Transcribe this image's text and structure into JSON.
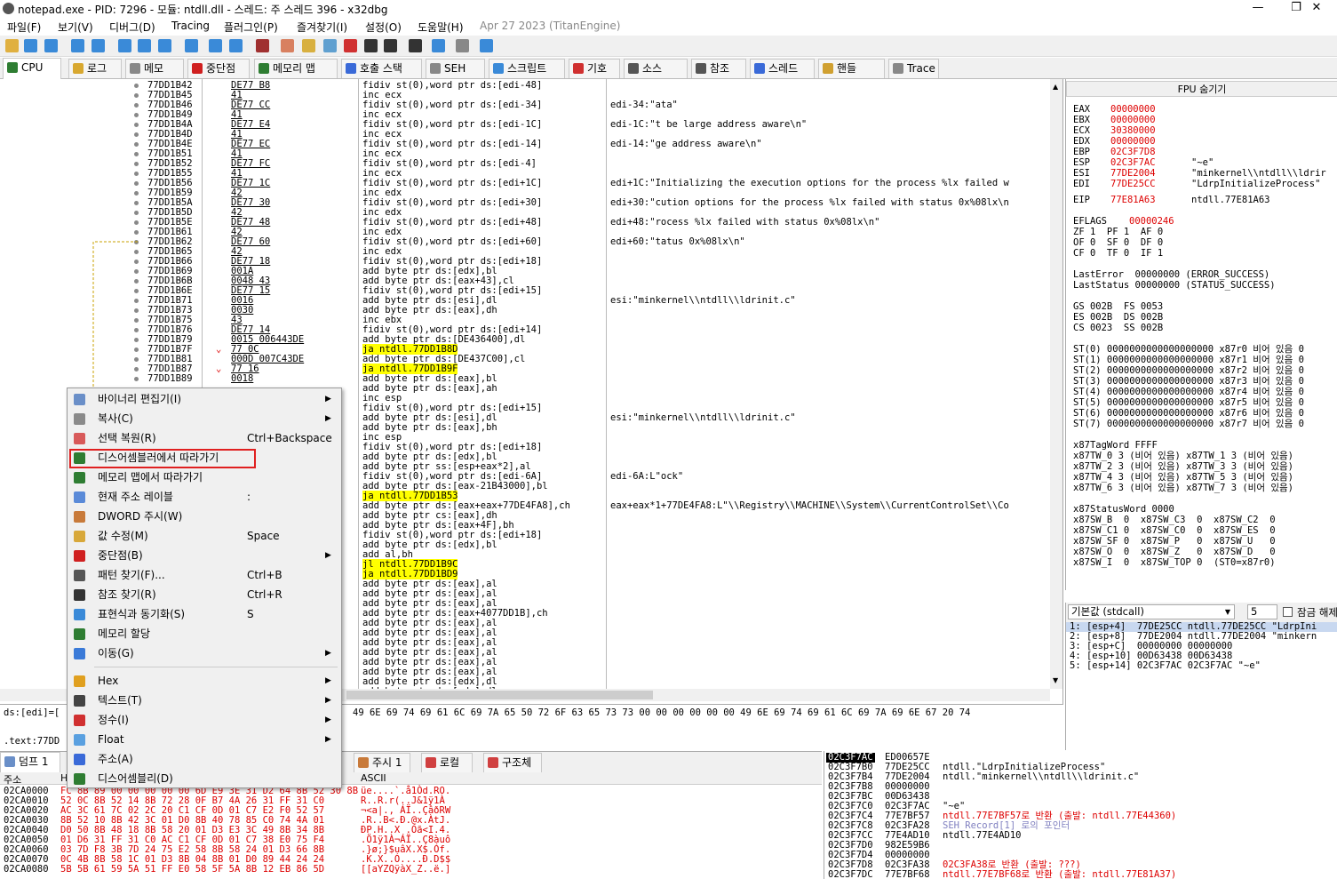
{
  "title": "notepad.exe - PID: 7296 - 모듈: ntdll.dll - 스레드: 주 스레드 396 - x32dbg",
  "menu": [
    "파일(F)",
    "보기(V)",
    "디버그(D)",
    "Tracing",
    "플러그인(P)",
    "즐겨찾기(I)",
    "설정(O)",
    "도움말(H)"
  ],
  "menu_date": "Apr 27 2023 (TitanEngine)",
  "tabs": [
    "CPU",
    "로그",
    "메모",
    "중단점",
    "메모리 맵",
    "호출 스택",
    "SEH",
    "스크립트",
    "기호",
    "소스",
    "참조",
    "스레드",
    "핸들",
    "Trace"
  ],
  "disasm": [
    {
      "a": "77DD1B42",
      "b": "DE77 B8",
      "i": "fidiv st(0),word ptr ds:[edi-48]",
      "c": ""
    },
    {
      "a": "77DD1B45",
      "b": "41",
      "i": "inc ecx",
      "c": ""
    },
    {
      "a": "77DD1B46",
      "b": "DE77 CC",
      "i": "fidiv st(0),word ptr ds:[edi-34]",
      "c": "edi-34:\"ata\""
    },
    {
      "a": "77DD1B49",
      "b": "41",
      "i": "inc ecx",
      "c": ""
    },
    {
      "a": "77DD1B4A",
      "b": "DE77 E4",
      "i": "fidiv st(0),word ptr ds:[edi-1C]",
      "c": "edi-1C:\"t be large address aware\\n\""
    },
    {
      "a": "77DD1B4D",
      "b": "41",
      "i": "inc ecx",
      "c": ""
    },
    {
      "a": "77DD1B4E",
      "b": "DE77 EC",
      "i": "fidiv st(0),word ptr ds:[edi-14]",
      "c": "edi-14:\"ge address aware\\n\""
    },
    {
      "a": "77DD1B51",
      "b": "41",
      "i": "inc ecx",
      "c": ""
    },
    {
      "a": "77DD1B52",
      "b": "DE77 FC",
      "i": "fidiv st(0),word ptr ds:[edi-4]",
      "c": ""
    },
    {
      "a": "77DD1B55",
      "b": "41",
      "i": "inc ecx",
      "c": ""
    },
    {
      "a": "77DD1B56",
      "b": "DE77 1C",
      "i": "fidiv st(0),word ptr ds:[edi+1C]",
      "c": "edi+1C:\"Initializing the execution options for the process %lx failed w"
    },
    {
      "a": "77DD1B59",
      "b": "42",
      "i": "inc edx",
      "c": ""
    },
    {
      "a": "77DD1B5A",
      "b": "DE77 30",
      "i": "fidiv st(0),word ptr ds:[edi+30]",
      "c": "edi+30:\"cution options for the process %lx failed with status 0x%08lx\\n"
    },
    {
      "a": "77DD1B5D",
      "b": "42",
      "i": "inc edx",
      "c": ""
    },
    {
      "a": "77DD1B5E",
      "b": "DE77 48",
      "i": "fidiv st(0),word ptr ds:[edi+48]",
      "c": "edi+48:\"rocess %lx failed with status 0x%08lx\\n\""
    },
    {
      "a": "77DD1B61",
      "b": "42",
      "i": "inc edx",
      "c": ""
    },
    {
      "a": "77DD1B62",
      "b": "DE77 60",
      "i": "fidiv st(0),word ptr ds:[edi+60]",
      "c": "edi+60:\"tatus 0x%08lx\\n\""
    },
    {
      "a": "77DD1B65",
      "b": "42",
      "i": "inc edx",
      "c": ""
    },
    {
      "a": "77DD1B66",
      "b": "DE77 18",
      "i": "fidiv st(0),word ptr ds:[edi+18]",
      "c": ""
    },
    {
      "a": "77DD1B69",
      "b": "001A",
      "i": "add byte ptr ds:[edx],bl",
      "c": ""
    },
    {
      "a": "77DD1B6B",
      "b": "0048 43",
      "i": "add byte ptr ds:[eax+43],cl",
      "c": ""
    },
    {
      "a": "77DD1B6E",
      "b": "DE77 15",
      "i": "fidiv st(0),word ptr ds:[edi+15]",
      "c": ""
    },
    {
      "a": "77DD1B71",
      "b": "0016",
      "i": "add byte ptr ds:[esi],dl",
      "c": "esi:\"minkernel\\\\ntdll\\\\ldrinit.c\""
    },
    {
      "a": "77DD1B73",
      "b": "0030",
      "i": "add byte ptr ds:[eax],dh",
      "c": ""
    },
    {
      "a": "77DD1B75",
      "b": "43",
      "i": "inc ebx",
      "c": ""
    },
    {
      "a": "77DD1B76",
      "b": "DE77 14",
      "i": "fidiv st(0),word ptr ds:[edi+14]",
      "c": ""
    },
    {
      "a": "77DD1B79",
      "b": "0015 006443DE",
      "i": "add byte ptr ds:[DE436400],dl",
      "c": ""
    },
    {
      "a": "77DD1B7F",
      "b": "77 0C",
      "i": "ja ntdll.77DD1B8D",
      "c": "",
      "j": 1
    },
    {
      "a": "77DD1B81",
      "b": "000D 007C43DE",
      "i": "add byte ptr ds:[DE437C00],cl",
      "c": ""
    },
    {
      "a": "77DD1B87",
      "b": "77 16",
      "i": "ja ntdll.77DD1B9F",
      "c": "",
      "j": 1
    },
    {
      "a": "77DD1B89",
      "b": "0018",
      "i": "add byte ptr ds:[eax],bl",
      "c": ""
    },
    {
      "a": "",
      "b": "",
      "i": "add byte ptr ds:[eax],ah",
      "c": ""
    },
    {
      "a": "",
      "b": "",
      "i": "inc esp",
      "c": ""
    },
    {
      "a": "",
      "b": "",
      "i": "fidiv st(0),word ptr ds:[edi+15]",
      "c": ""
    },
    {
      "a": "",
      "b": "",
      "i": "add byte ptr ds:[esi],dl",
      "c": "esi:\"minkernel\\\\ntdll\\\\ldrinit.c\""
    },
    {
      "a": "",
      "b": "",
      "i": "add byte ptr ds:[eax],bh",
      "c": ""
    },
    {
      "a": "",
      "b": "",
      "i": "inc esp",
      "c": ""
    },
    {
      "a": "",
      "b": "",
      "i": "fidiv st(0),word ptr ds:[edi+18]",
      "c": ""
    },
    {
      "a": "",
      "b": "",
      "i": "add byte ptr ds:[edx],bl",
      "c": ""
    },
    {
      "a": "",
      "b": "",
      "i": "add byte ptr ss:[esp+eax*2],al",
      "c": ""
    },
    {
      "a": "",
      "b": "",
      "i": "fidiv st(0),word ptr ds:[edi-6A]",
      "c": "edi-6A:L\"ock\""
    },
    {
      "a": "",
      "b": "",
      "i": "add byte ptr ds:[eax-21B43000],bl",
      "c": ""
    },
    {
      "a": "",
      "b": "",
      "i": "ja ntdll.77DD1B53",
      "c": "",
      "j": 1
    },
    {
      "a": "",
      "b": "",
      "i": "add byte ptr ds:[eax+eax+77DE4FA8],ch",
      "c": "eax+eax*1+77DE4FA8:L\"\\\\Registry\\\\MACHINE\\\\System\\\\CurrentControlSet\\\\Co"
    },
    {
      "a": "",
      "b": "",
      "i": "add byte ptr cs:[eax],dh",
      "c": ""
    },
    {
      "a": "",
      "b": "",
      "i": "add byte ptr ds:[eax+4F],bh",
      "c": ""
    },
    {
      "a": "",
      "b": "",
      "i": "fidiv st(0),word ptr ds:[edi+18]",
      "c": ""
    },
    {
      "a": "",
      "b": "",
      "i": "add byte ptr ds:[edx],bl",
      "c": ""
    },
    {
      "a": "",
      "b": "",
      "i": "add al,bh",
      "c": ""
    },
    {
      "a": "",
      "b": "",
      "i": "jl ntdll.77DD1B9C",
      "c": "",
      "j": 1
    },
    {
      "a": "",
      "b": "",
      "i": "ja ntdll.77DD1BD9",
      "c": "",
      "j": 1
    },
    {
      "a": "",
      "b": "",
      "i": "add byte ptr ds:[eax],al",
      "c": ""
    },
    {
      "a": "",
      "b": "",
      "i": "add byte ptr ds:[eax],al",
      "c": ""
    },
    {
      "a": "",
      "b": "",
      "i": "add byte ptr ds:[eax],al",
      "c": ""
    },
    {
      "a": "",
      "b": "",
      "i": "add byte ptr ds:[eax+4077DD1B],ch",
      "c": ""
    },
    {
      "a": "",
      "b": "",
      "i": "add byte ptr ds:[eax],al",
      "c": ""
    },
    {
      "a": "",
      "b": "",
      "i": "add byte ptr ds:[eax],al",
      "c": ""
    },
    {
      "a": "",
      "b": "",
      "i": "add byte ptr ds:[eax],al",
      "c": ""
    },
    {
      "a": "",
      "b": "",
      "i": "add byte ptr ds:[eax],al",
      "c": ""
    },
    {
      "a": "",
      "b": "",
      "i": "add byte ptr ds:[eax],al",
      "c": ""
    },
    {
      "a": "",
      "b": "",
      "i": "add byte ptr ds:[eax],al",
      "c": ""
    },
    {
      "a": "",
      "b": "",
      "i": "add byte ptr ds:[edx],dl",
      "c": ""
    },
    {
      "a": "",
      "b": "",
      "i": "add byte ptr ds:[edx],dl",
      "c": ""
    }
  ],
  "info": {
    "line1": "ds:[edi]=[",
    "hexrow": "49 6E 69 74 69 61 6C 69 7A 65 50 72 6F 63 65 73 73 00 00 00 00 00 00 49 6E 69 74 69 61 6C 69 7A 69 6E 67 20 74",
    "line2": ".text:77DD"
  },
  "fpu": {
    "header": "FPU 숨기기",
    "regs": [
      {
        "n": "EAX",
        "v": "00000000",
        "c": ""
      },
      {
        "n": "EBX",
        "v": "00000000",
        "c": ""
      },
      {
        "n": "ECX",
        "v": "30380000",
        "c": ""
      },
      {
        "n": "EDX",
        "v": "00000000",
        "c": ""
      },
      {
        "n": "EBP",
        "v": "02C3F7D8",
        "c": ""
      },
      {
        "n": "ESP",
        "v": "02C3F7AC",
        "c": "\"~e\""
      },
      {
        "n": "ESI",
        "v": "77DE2004",
        "c": "\"minkernel\\\\ntdll\\\\ldrir"
      },
      {
        "n": "EDI",
        "v": "77DE25CC",
        "c": "\"LdrpInitializeProcess\""
      }
    ],
    "eip": {
      "n": "EIP",
      "v": "77E81A63",
      "c": "ntdll.77E81A63"
    },
    "eflags": {
      "n": "EFLAGS",
      "v": "00000246"
    },
    "flags": [
      "ZF 1  PF 1  AF 0",
      "OF 0  SF 0  DF 0",
      "CF 0  TF 0  IF 1"
    ],
    "lasterr": [
      "LastError  00000000 (ERROR_SUCCESS)",
      "LastStatus 00000000 (STATUS_SUCCESS)"
    ],
    "segs": [
      "GS 002B  FS 0053",
      "ES 002B  DS 002B",
      "CS 0023  SS 002B"
    ],
    "st": [
      "ST(0) 0000000000000000000 x87r0 비어 있음 0",
      "ST(1) 0000000000000000000 x87r1 비어 있음 0",
      "ST(2) 0000000000000000000 x87r2 비어 있음 0",
      "ST(3) 0000000000000000000 x87r3 비어 있음 0",
      "ST(4) 0000000000000000000 x87r4 비어 있음 0",
      "ST(5) 0000000000000000000 x87r5 비어 있음 0",
      "ST(6) 0000000000000000000 x87r6 비어 있음 0",
      "ST(7) 0000000000000000000 x87r7 비어 있음 0"
    ],
    "tag": [
      "x87TagWord FFFF",
      "x87TW_0 3 (비어 있음) x87TW_1 3 (비어 있음)",
      "x87TW_2 3 (비어 있음) x87TW_3 3 (비어 있음)",
      "x87TW_4 3 (비어 있음) x87TW_5 3 (비어 있음)",
      "x87TW_6 3 (비어 있음) x87TW_7 3 (비어 있음)"
    ],
    "sw": [
      "x87StatusWord 0000",
      "x87SW_B  0  x87SW_C3  0  x87SW_C2  0",
      "x87SW_C1 0  x87SW_C0  0  x87SW_ES  0",
      "x87SW_SF 0  x87SW_P   0  x87SW_U   0",
      "x87SW_O  0  x87SW_Z   0  x87SW_D   0",
      "x87SW_I  0  x87SW_TOP 0  (ST0=x87r0)"
    ]
  },
  "callconv": {
    "select": "기본값 (stdcall)",
    "count": "5",
    "lock": "잠금 해제",
    "rows": [
      "1: [esp+4]  77DE25CC ntdll.77DE25CC \"LdrpIni",
      "2: [esp+8]  77DE2004 ntdll.77DE2004 \"minkern",
      "3: [esp+C]  00000000 00000000",
      "4: [esp+10] 00D63438 00D63438",
      "5: [esp+14] 02C3F7AC 02C3F7AC \"~e\""
    ]
  },
  "bottom_tabs": [
    "덤프 1",
    "주시 1",
    "로컬",
    "구조체"
  ],
  "dump": {
    "h_addr": "주소",
    "h_hex": "H",
    "h_ascii": "ASCII",
    "rows": [
      {
        "a": "02CA0000",
        "h": "FC 8B 89 00 00 00 00 00 6D E9 3E 31 D2 64 8B 52 30 8B",
        "s": "üe....`.å1Òd.RO."
      },
      {
        "a": "02CA0010",
        "h": "52 0C 8B 52 14 8B 72 28 0F B7 4A 26 31 FF 31 C0",
        "s": "R..R.r(..J&1ÿ1À"
      },
      {
        "a": "02CA0020",
        "h": "AC 3C 61 7C 02 2C 20 C1 CF 0D 01 C7 E2 F0 52 57",
        "s": "¬<a|., ÁÏ..ÇâðRW"
      },
      {
        "a": "02CA0030",
        "h": "8B 52 10 8B 42 3C 01 D0 8B 40 78 85 C0 74 4A 01",
        "s": ".R..B<.Ð.@x.ÀtJ."
      },
      {
        "a": "02CA0040",
        "h": "D0 50 8B 48 18 8B 58 20 01 D3 E3 3C 49 8B 34 8B",
        "s": "ÐP.H..X .Óã<I.4."
      },
      {
        "a": "02CA0050",
        "h": "01 D6 31 FF 31 C0 AC C1 CF 0D 01 C7 38 E0 75 F4",
        "s": ".Ö1ÿ1À¬ÁÏ..Ç8àuô"
      },
      {
        "a": "02CA0060",
        "h": "03 7D F8 3B 7D 24 75 E2 58 8B 58 24 01 D3 66 8B",
        "s": ".}ø;}$uâX.X$.Óf."
      },
      {
        "a": "02CA0070",
        "h": "0C 4B 8B 58 1C 01 D3 8B 04 8B 01 D0 89 44 24 24",
        "s": ".K.X..Ó....Ð.D$$"
      },
      {
        "a": "02CA0080",
        "h": "5B 5B 61 59 5A 51 FF E0 58 5F 5A 8B 12 EB 86 5D",
        "s": "[[aYZQÿàX_Z..ë.]"
      }
    ]
  },
  "stack": {
    "hdr_addr": "02C3F7AC",
    "hdr_val": "ED00657E",
    "rows": [
      {
        "a": "02C3F7B0",
        "v": "77DE25CC",
        "c": "ntdll.\"LdrpInitializeProcess\"",
        "red": false
      },
      {
        "a": "02C3F7B4",
        "v": "77DE2004",
        "c": "ntdll.\"minkernel\\\\ntdll\\\\ldrinit.c\"",
        "red": false
      },
      {
        "a": "02C3F7B8",
        "v": "00000000",
        "c": "",
        "red": false
      },
      {
        "a": "02C3F7BC",
        "v": "00D63438",
        "c": "",
        "red": false
      },
      {
        "a": "02C3F7C0",
        "v": "02C3F7AC",
        "c": "\"~e\"",
        "red": false
      },
      {
        "a": "02C3F7C4",
        "v": "77E7BF57",
        "c": "ntdll.77E7BF57로 반환 (출발: ntdll.77E44360)",
        "red": true
      },
      {
        "a": "02C3F7C8",
        "v": "02C3FA28",
        "c": "SEH_Record[1] 로의 포인터",
        "red": false,
        "gray": true
      },
      {
        "a": "02C3F7CC",
        "v": "77E4AD10",
        "c": "ntdll.77E4AD10",
        "red": false
      },
      {
        "a": "02C3F7D0",
        "v": "982E59B6",
        "c": "",
        "red": false
      },
      {
        "a": "02C3F7D4",
        "v": "00000000",
        "c": "",
        "red": false
      },
      {
        "a": "02C3F7D8",
        "v": "02C3FA38",
        "c": "02C3FA38로 반환 (출발: ???)",
        "red": true
      },
      {
        "a": "02C3F7DC",
        "v": "77E7BF68",
        "c": "ntdll.77E7BF68로 반환 (출발: ntdll.77E81A37)",
        "red": true
      }
    ]
  },
  "context_menu": [
    {
      "label": "바이너리 편집기(I)",
      "shortcut": "",
      "arrow": "▶",
      "color": "#6a8fc8"
    },
    {
      "label": "복사(C)",
      "shortcut": "",
      "arrow": "▶",
      "color": "#8a8a8a"
    },
    {
      "label": "선택 복원(R)",
      "shortcut": "Ctrl+Backspace",
      "arrow": "",
      "color": "#d85a5a"
    },
    {
      "label": "디스어셈블러에서 따라가기",
      "shortcut": "",
      "arrow": "",
      "color": "#2e7d32",
      "boxed": true
    },
    {
      "label": "메모리 맵에서 따라가기",
      "shortcut": "",
      "arrow": "",
      "color": "#2e7d32"
    },
    {
      "label": "현재 주소 레이블",
      "shortcut": ":",
      "arrow": "",
      "color": "#5a8ad8"
    },
    {
      "label": "DWORD 주시(W)",
      "shortcut": "",
      "arrow": "",
      "color": "#c87a3a"
    },
    {
      "label": "값 수정(M)",
      "shortcut": "Space",
      "arrow": "",
      "color": "#d8a83a"
    },
    {
      "label": "중단점(B)",
      "shortcut": "",
      "arrow": "▶",
      "color": "#d02020"
    },
    {
      "label": "패턴 찾기(F)...",
      "shortcut": "Ctrl+B",
      "arrow": "",
      "color": "#555"
    },
    {
      "label": "참조 찾기(R)",
      "shortcut": "Ctrl+R",
      "arrow": "",
      "color": "#333"
    },
    {
      "label": "표현식과 동기화(S)",
      "shortcut": "S",
      "arrow": "",
      "color": "#3a8ad8"
    },
    {
      "label": "메모리 할당",
      "shortcut": "",
      "arrow": "",
      "color": "#2e7d32"
    },
    {
      "label": "이동(G)",
      "shortcut": "",
      "arrow": "▶",
      "color": "#3a7ad8"
    },
    {
      "label": "Hex",
      "shortcut": "",
      "arrow": "▶",
      "color": "#e0a020",
      "sepBefore": true
    },
    {
      "label": "텍스트(T)",
      "shortcut": "",
      "arrow": "▶",
      "color": "#444"
    },
    {
      "label": "정수(I)",
      "shortcut": "",
      "arrow": "▶",
      "color": "#d03030"
    },
    {
      "label": "Float",
      "shortcut": "",
      "arrow": "▶",
      "color": "#5aa0e0"
    },
    {
      "label": "주소(A)",
      "shortcut": "",
      "arrow": "",
      "color": "#3a6ad8"
    },
    {
      "label": "디스어셈블리(D)",
      "shortcut": "",
      "arrow": "",
      "color": "#2e7d32"
    }
  ]
}
